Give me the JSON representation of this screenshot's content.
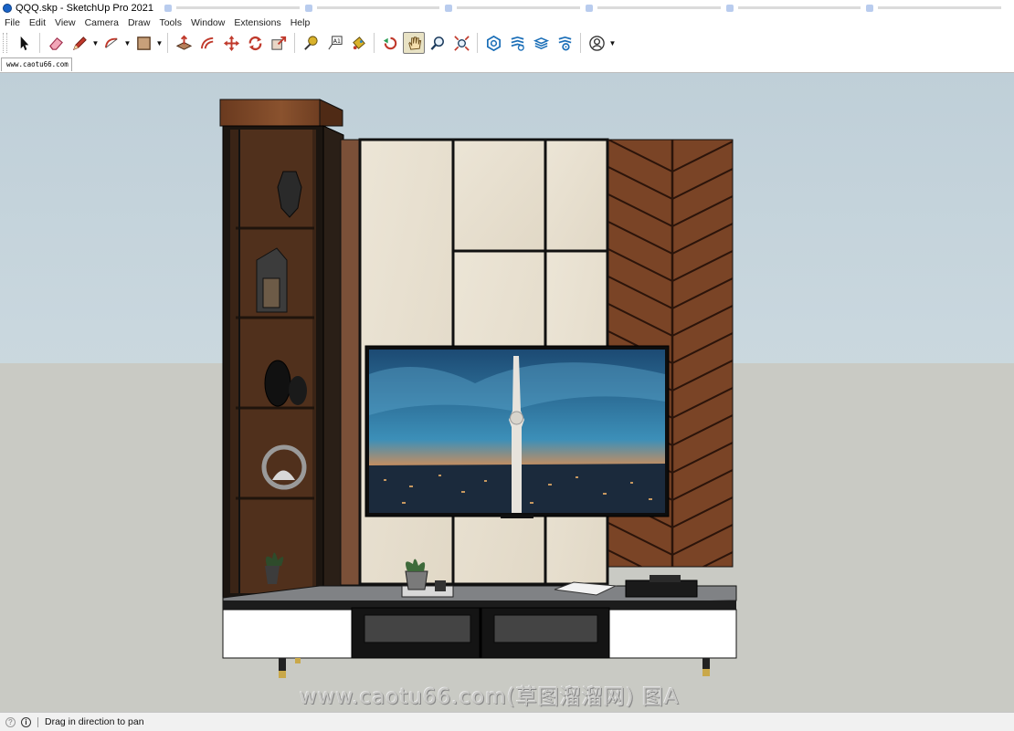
{
  "window": {
    "title": "QQQ.skp - SketchUp Pro 2021"
  },
  "menu": [
    "File",
    "Edit",
    "View",
    "Camera",
    "Draw",
    "Tools",
    "Window",
    "Extensions",
    "Help"
  ],
  "toolbar": {
    "tools": [
      {
        "name": "select-tool-icon"
      },
      {
        "name": "eraser-tool-icon"
      },
      {
        "name": "pencil-line-tool-icon",
        "has_dropdown": true
      },
      {
        "name": "arc-tool-icon",
        "has_dropdown": true
      },
      {
        "name": "rectangle-tool-icon",
        "has_dropdown": true
      },
      {
        "name": "push-pull-tool-icon"
      },
      {
        "name": "offset-tool-icon"
      },
      {
        "name": "move-tool-icon"
      },
      {
        "name": "rotate-tool-icon"
      },
      {
        "name": "scale-tool-icon"
      },
      {
        "name": "tape-measure-tool-icon"
      },
      {
        "name": "text-tool-icon"
      },
      {
        "name": "paint-bucket-tool-icon"
      },
      {
        "name": "orbit-tool-icon"
      },
      {
        "name": "pan-tool-icon",
        "active": true
      },
      {
        "name": "zoom-tool-icon"
      },
      {
        "name": "zoom-extents-tool-icon"
      },
      {
        "name": "3d-warehouse-icon"
      },
      {
        "name": "extension-warehouse-icon"
      },
      {
        "name": "layout-icon"
      },
      {
        "name": "extension-manager-icon"
      },
      {
        "name": "account-icon",
        "has_dropdown": true
      }
    ],
    "accent": "#1b6fb8"
  },
  "scene_tab": {
    "label": "www.caotu66.com"
  },
  "viewport": {
    "sky_color": "#c6d4dc",
    "ground_color": "#c9cac4",
    "watermark": "www.caotu66.com(草图溜溜网) 图A"
  },
  "status": {
    "text": "Drag in direction to pan"
  }
}
